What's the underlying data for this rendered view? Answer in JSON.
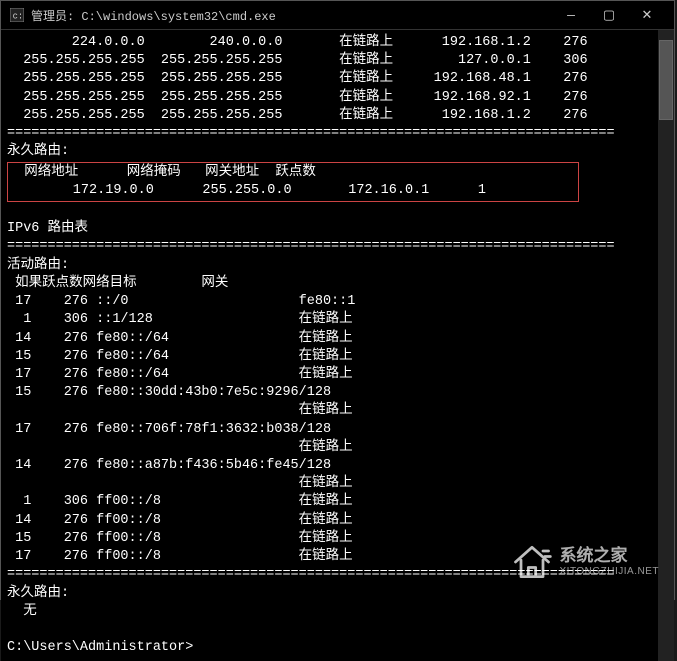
{
  "window": {
    "title": "管理员: C:\\windows\\system32\\cmd.exe"
  },
  "ipv4": {
    "active_rows": [
      {
        "dest": "224.0.0.0",
        "mask": "240.0.0.0",
        "gateway": "在链路上",
        "iface": "192.168.1.2",
        "metric": "276"
      },
      {
        "dest": "255.255.255.255",
        "mask": "255.255.255.255",
        "gateway": "在链路上",
        "iface": "127.0.0.1",
        "metric": "306"
      },
      {
        "dest": "255.255.255.255",
        "mask": "255.255.255.255",
        "gateway": "在链路上",
        "iface": "192.168.48.1",
        "metric": "276"
      },
      {
        "dest": "255.255.255.255",
        "mask": "255.255.255.255",
        "gateway": "在链路上",
        "iface": "192.168.92.1",
        "metric": "276"
      },
      {
        "dest": "255.255.255.255",
        "mask": "255.255.255.255",
        "gateway": "在链路上",
        "iface": "192.168.1.2",
        "metric": "276"
      }
    ],
    "separator": "===========================================================================",
    "persistent_label": "永久路由:",
    "persistent_headers": {
      "dest": "网络地址",
      "mask": "网络掩码",
      "gateway": "网关地址",
      "metric": "跃点数"
    },
    "persistent_rows": [
      {
        "dest": "172.19.0.0",
        "mask": "255.255.0.0",
        "gateway": "172.16.0.1",
        "metric": "1"
      }
    ]
  },
  "ipv6": {
    "title": "IPv6 路由表",
    "active_label": "活动路由:",
    "headers": "如果跃点数网络目标        网关",
    "rows": [
      {
        "if": "17",
        "metric": "276",
        "dest": "::/0",
        "gateway": "fe80::1"
      },
      {
        "if": "1",
        "metric": "306",
        "dest": "::1/128",
        "gateway": "在链路上"
      },
      {
        "if": "14",
        "metric": "276",
        "dest": "fe80::/64",
        "gateway": "在链路上"
      },
      {
        "if": "15",
        "metric": "276",
        "dest": "fe80::/64",
        "gateway": "在链路上"
      },
      {
        "if": "17",
        "metric": "276",
        "dest": "fe80::/64",
        "gateway": "在链路上"
      },
      {
        "if": "15",
        "metric": "276",
        "dest": "fe80::30dd:43b0:7e5c:9296/128",
        "gateway": "在链路上"
      },
      {
        "if": "17",
        "metric": "276",
        "dest": "fe80::706f:78f1:3632:b038/128",
        "gateway": "在链路上"
      },
      {
        "if": "14",
        "metric": "276",
        "dest": "fe80::a87b:f436:5b46:fe45/128",
        "gateway": "在链路上"
      },
      {
        "if": "1",
        "metric": "306",
        "dest": "ff00::/8",
        "gateway": "在链路上"
      },
      {
        "if": "14",
        "metric": "276",
        "dest": "ff00::/8",
        "gateway": "在链路上"
      },
      {
        "if": "15",
        "metric": "276",
        "dest": "ff00::/8",
        "gateway": "在链路上"
      },
      {
        "if": "17",
        "metric": "276",
        "dest": "ff00::/8",
        "gateway": "在链路上"
      }
    ],
    "persistent_label": "永久路由:",
    "persistent_none": "无"
  },
  "prompt": "C:\\Users\\Administrator>",
  "watermark": {
    "cn": "系统之家",
    "en": "XITONGZHIJIA.NET"
  }
}
